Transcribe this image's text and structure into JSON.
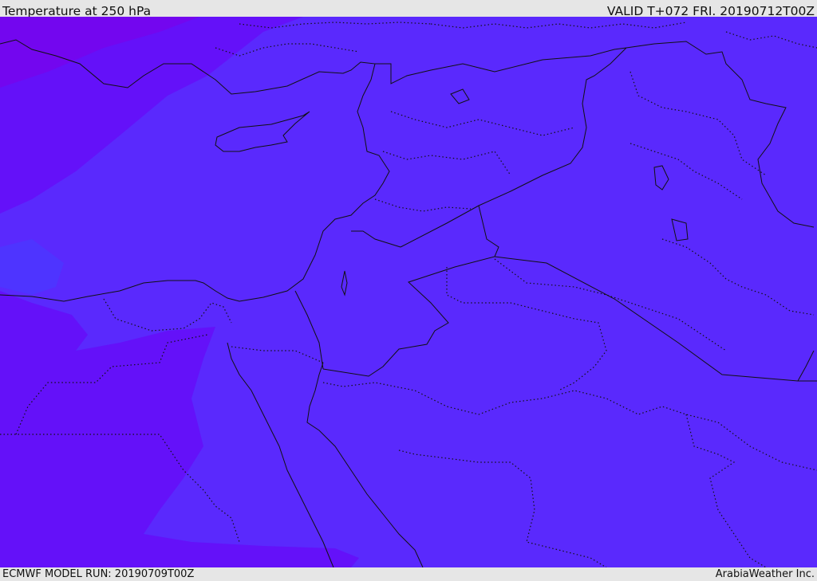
{
  "header": {
    "title": "Temperature at 250 hPa",
    "valid_time": "VALID T+072 FRI. 20190712T00Z"
  },
  "footer": {
    "model_run": "ECMWF MODEL RUN: 20190709T00Z",
    "credit": "ArabiaWeather Inc."
  },
  "map": {
    "colors": {
      "field_main": "#5a29fd",
      "field_cold_band": "#6411f9",
      "field_coldest_band": "#7306ef",
      "field_transition": "#4e34ff",
      "border_line": "#111111"
    }
  }
}
